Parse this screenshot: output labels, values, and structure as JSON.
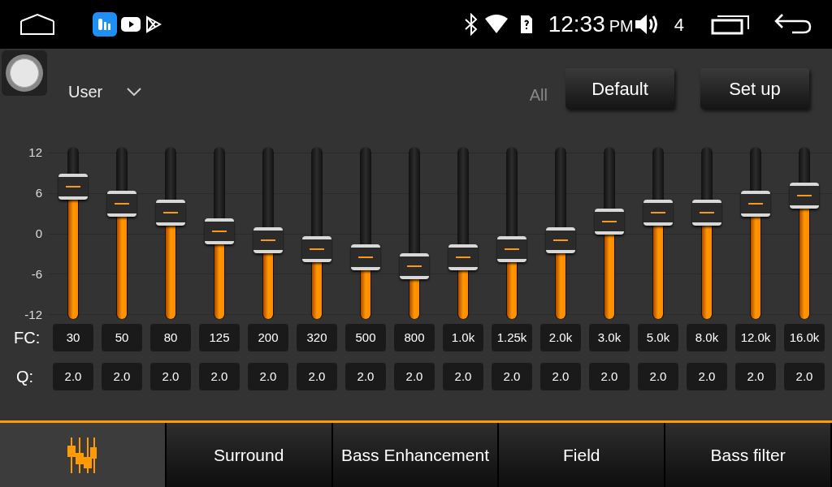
{
  "status_bar": {
    "time": "12:33",
    "meridiem": "PM",
    "volume": "4"
  },
  "header": {
    "preset": "User",
    "all_label": "All",
    "buttons": [
      "Default",
      "Set up"
    ]
  },
  "scale": [
    "12",
    "6",
    "0",
    "-6",
    "-12"
  ],
  "fc_label": "FC:",
  "q_label": "Q:",
  "bands": [
    {
      "fc": "30",
      "q": "2.0",
      "level": 0.77
    },
    {
      "fc": "50",
      "q": "2.0",
      "level": 0.67
    },
    {
      "fc": "80",
      "q": "2.0",
      "level": 0.62
    },
    {
      "fc": "125",
      "q": "2.0",
      "level": 0.51
    },
    {
      "fc": "200",
      "q": "2.0",
      "level": 0.46
    },
    {
      "fc": "320",
      "q": "2.0",
      "level": 0.41
    },
    {
      "fc": "500",
      "q": "2.0",
      "level": 0.36
    },
    {
      "fc": "800",
      "q": "2.0",
      "level": 0.31
    },
    {
      "fc": "1.0k",
      "q": "2.0",
      "level": 0.36
    },
    {
      "fc": "1.25k",
      "q": "2.0",
      "level": 0.41
    },
    {
      "fc": "2.0k",
      "q": "2.0",
      "level": 0.46
    },
    {
      "fc": "3.0k",
      "q": "2.0",
      "level": 0.57
    },
    {
      "fc": "5.0k",
      "q": "2.0",
      "level": 0.62
    },
    {
      "fc": "8.0k",
      "q": "2.0",
      "level": 0.62
    },
    {
      "fc": "12.0k",
      "q": "2.0",
      "level": 0.67
    },
    {
      "fc": "16.0k",
      "q": "2.0",
      "level": 0.72
    }
  ],
  "tabs": [
    {
      "kind": "icon",
      "selected": true
    },
    {
      "kind": "text",
      "label": "Surround",
      "selected": false
    },
    {
      "kind": "text",
      "label": "Bass Enhancement",
      "selected": false
    },
    {
      "kind": "text",
      "label": "Field",
      "selected": false
    },
    {
      "kind": "text",
      "label": "Bass filter",
      "selected": false
    }
  ]
}
